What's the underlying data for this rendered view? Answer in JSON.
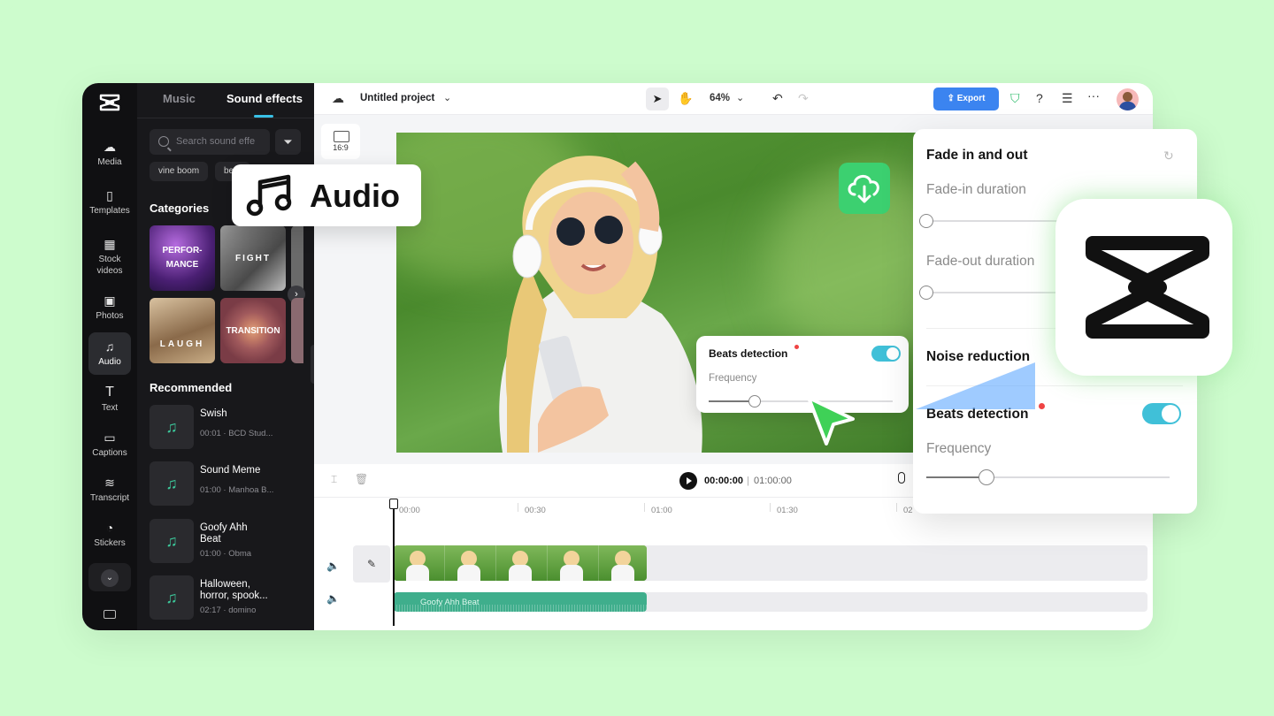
{
  "nav": {
    "items": [
      {
        "label": "Media",
        "icon": "cloud-upload-icon"
      },
      {
        "label": "Templates",
        "icon": "template-icon"
      },
      {
        "label": "Stock videos",
        "icon": "film-icon"
      },
      {
        "label": "Photos",
        "icon": "image-icon"
      },
      {
        "label": "Audio",
        "icon": "music-icon",
        "active": true
      },
      {
        "label": "Text",
        "icon": "text-icon"
      },
      {
        "label": "Captions",
        "icon": "captions-icon"
      },
      {
        "label": "Transcript",
        "icon": "transcript-icon"
      },
      {
        "label": "Stickers",
        "icon": "sticker-icon"
      }
    ]
  },
  "panel": {
    "tabs": {
      "music": "Music",
      "sound_effects": "Sound effects"
    },
    "search_placeholder": "Search sound effe",
    "chips": [
      "vine boom",
      "be"
    ],
    "categories_title": "Categories",
    "categories": [
      "PERFOR-\nMANCE",
      "FIGHT",
      "LAUGH",
      "TRANSITION"
    ],
    "recommended_title": "Recommended",
    "recommended": [
      {
        "title": "Swish",
        "meta": "00:01 · BCD Stud..."
      },
      {
        "title": "Sound Meme",
        "meta": "01:00 · Manhoa B..."
      },
      {
        "title": "Goofy Ahh Beat",
        "meta": "01:00 · Obma"
      },
      {
        "title": "Halloween, horror, spook...",
        "meta": "02:17 · domino"
      }
    ]
  },
  "topbar": {
    "project_name": "Untitled project",
    "zoom": "64%",
    "export_label": "Export"
  },
  "canvas": {
    "ratio": "16:9"
  },
  "beats_popup": {
    "title": "Beats detection",
    "frequency_label": "Frequency",
    "enabled": true,
    "frequency_value": 0.25
  },
  "timeline": {
    "current_time": "00:00:00",
    "separator": "|",
    "total_time": "01:00:00",
    "ruler": [
      "00:00",
      "00:30",
      "01:00",
      "01:30",
      "02"
    ],
    "audio_clip_label": "Goofy Ahh Beat"
  },
  "side_panel": {
    "fade_title": "Fade in and out",
    "fade_in_label": "Fade-in duration",
    "fade_out_label": "Fade-out duration",
    "noise_title": "Noise reduction",
    "beats_title": "Beats detection",
    "frequency_label": "Frequency",
    "beats_enabled": true,
    "frequency_value": 0.25
  },
  "overlay": {
    "audio_label": "Audio"
  },
  "colors": {
    "background": "#cdfccd",
    "accent": "#40c0d8",
    "export": "#3b84f0",
    "download": "#3cd070",
    "audio_clip": "#3fae8c"
  }
}
